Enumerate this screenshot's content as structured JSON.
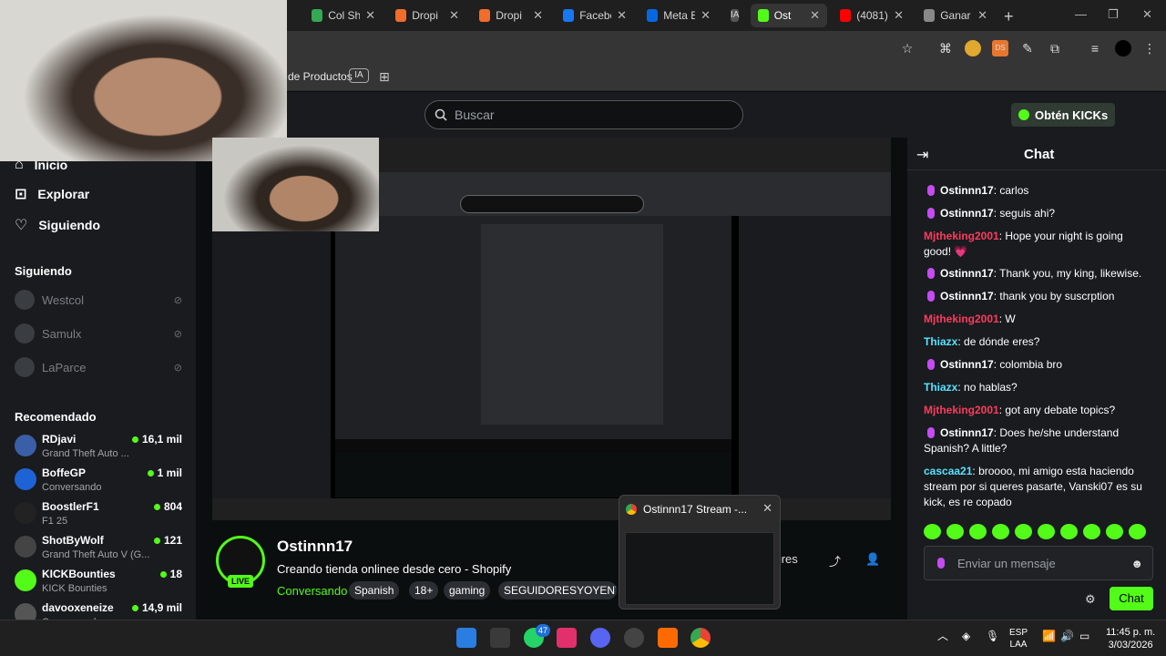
{
  "browser": {
    "tabs": [
      {
        "label": "Col Sh",
        "color": "#34a853"
      },
      {
        "label": "Dropi",
        "color": "#f26c2b"
      },
      {
        "label": "Dropi",
        "color": "#f26c2b"
      },
      {
        "label": "Facebo",
        "color": "#1877f2"
      },
      {
        "label": "Meta B",
        "color": "#0668e1"
      },
      {
        "label": "IA",
        "color": "#555"
      },
      {
        "label": "Ost",
        "color": "#53fc18"
      },
      {
        "label": "(4081)",
        "color": "#ff0000"
      },
      {
        "label": "Ganar d",
        "color": "#888"
      }
    ],
    "bookmark_text": "de Productos",
    "bookmark_ia": "IA"
  },
  "header": {
    "search_placeholder": "Buscar",
    "get_kicks": "Obtén KICKs"
  },
  "sidebar": {
    "nav": [
      {
        "label": "Inicio",
        "icon": "home-icon"
      },
      {
        "label": "Explorar",
        "icon": "compass-icon"
      },
      {
        "label": "Siguiendo",
        "icon": "heart-icon"
      }
    ],
    "following_title": "Siguiendo",
    "following": [
      "Westcol",
      "Samulx",
      "LaParce"
    ],
    "recommended_title": "Recomendado",
    "recommended": [
      {
        "name": "RDjavi",
        "category": "Grand Theft Auto ...",
        "viewers": "16,1 mil",
        "color": "#3a5fa8"
      },
      {
        "name": "BoffeGP",
        "category": "Conversando",
        "viewers": "1 mil",
        "color": "#1e63d6"
      },
      {
        "name": "BoostlerF1",
        "category": "F1 25",
        "viewers": "804",
        "color": "#222"
      },
      {
        "name": "ShotByWolf",
        "category": "Grand Theft Auto V (G...",
        "viewers": "121",
        "color": "#444"
      },
      {
        "name": "KICKBounties",
        "category": "KICK Bounties",
        "viewers": "18",
        "color": "#53fc18"
      },
      {
        "name": "davooxeneize",
        "category": "Conversando",
        "viewers": "14,9 mil",
        "color": "#555"
      }
    ]
  },
  "stream": {
    "name": "Ostinnn17",
    "title": "Creando tienda onlinee desde cero - Shopify",
    "category": "Conversando",
    "tags": [
      "Spanish",
      "18+",
      "gaming",
      "SEGUIDORESYOYENT"
    ],
    "live": "LIVE",
    "viewers_label": "ndores"
  },
  "popup": {
    "title": "Ostinnn17 Stream -..."
  },
  "chat": {
    "title": "Chat",
    "messages": [
      {
        "user": "Ostinnn17",
        "text": "carlos",
        "color": "#fff",
        "mic": true
      },
      {
        "user": "Ostinnn17",
        "text": "seguis ahi?",
        "color": "#fff",
        "mic": true
      },
      {
        "user": "Mjtheking2001",
        "text": "Hope your night is going good! 💗",
        "color": "#ff3b5c",
        "mic": false
      },
      {
        "user": "Ostinnn17",
        "text": "Thank you, my king, likewise.",
        "color": "#fff",
        "mic": true
      },
      {
        "user": "Ostinnn17",
        "text": "thank you by suscrption",
        "color": "#fff",
        "mic": true
      },
      {
        "user": "Mjtheking2001",
        "text": "W",
        "color": "#ff3b5c",
        "mic": false
      },
      {
        "user": "Thiazx",
        "text": "de dónde eres?",
        "color": "#57e3ff",
        "mic": false
      },
      {
        "user": "Ostinnn17",
        "text": "colombia bro",
        "color": "#fff",
        "mic": true
      },
      {
        "user": "Thiazx",
        "text": "no hablas?",
        "color": "#57e3ff",
        "mic": false
      },
      {
        "user": "Mjtheking2001",
        "text": "got any debate topics?",
        "color": "#ff3b5c",
        "mic": false
      },
      {
        "user": "Ostinnn17",
        "text": "Does he/she understand Spanish? A little?",
        "color": "#fff",
        "mic": true
      },
      {
        "user": "cascaa21",
        "text": "broooo, mi amigo esta haciendo stream por si queres pasarte, Vanski07 es su kick, es re copado",
        "color": "#57e3ff",
        "mic": false
      }
    ],
    "input_placeholder": "Enviar un mensaje",
    "send_label": "Chat"
  },
  "taskbar": {
    "whatsapp_badge": "47",
    "lang": "ESP",
    "layout": "LAA",
    "time": "11:45 p. m.",
    "date": "3/03/2026"
  }
}
